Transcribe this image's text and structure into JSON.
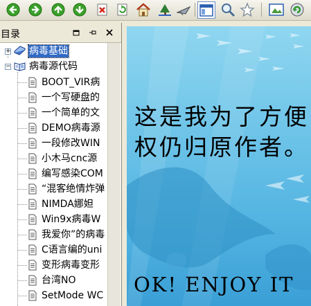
{
  "toolbar": {
    "buttons": [
      {
        "icon": "back-icon"
      },
      {
        "icon": "forward-icon"
      },
      {
        "icon": "up-icon"
      },
      {
        "icon": "down-icon"
      },
      {
        "icon": "stop-icon"
      },
      {
        "icon": "refresh-icon"
      },
      {
        "icon": "home-icon"
      },
      {
        "icon": "tree-icon"
      },
      {
        "icon": "plane-icon"
      },
      {
        "icon": "contents-icon"
      },
      {
        "icon": "search-icon"
      },
      {
        "icon": "favorites-icon"
      },
      {
        "icon": "picture-icon"
      },
      {
        "icon": "settings-icon"
      }
    ]
  },
  "sidebar": {
    "title": "目录",
    "tree": [
      {
        "label": "病毒基础",
        "type": "folder",
        "expanded": false,
        "selected": true
      },
      {
        "label": "病毒源代码",
        "type": "folder",
        "expanded": true,
        "selected": false,
        "children": [
          {
            "label": "BOOT_VIR病"
          },
          {
            "label": "一个写硬盘的"
          },
          {
            "label": "一个简单的文"
          },
          {
            "label": "DEMO病毒源"
          },
          {
            "label": "一段修改WIN"
          },
          {
            "label": "小木马cnc源"
          },
          {
            "label": "编写感染COM"
          },
          {
            "label": "“混客绝情炸弹"
          },
          {
            "label": "NIMDA娜妲"
          },
          {
            "label": "Win9x病毒W"
          },
          {
            "label": "我爱你”的病毒"
          },
          {
            "label": "C语言编的uni"
          },
          {
            "label": "变形病毒变形"
          },
          {
            "label": "台湾NO"
          },
          {
            "label": "SetMode WC"
          }
        ]
      }
    ]
  },
  "content": {
    "line1": "这是我为了方便",
    "line2": "权仍归原作者。",
    "footer": "OK! ENJOY IT",
    "colors": {
      "background_top": "#8fd6f0",
      "background_bottom": "#3a9fd6"
    }
  }
}
